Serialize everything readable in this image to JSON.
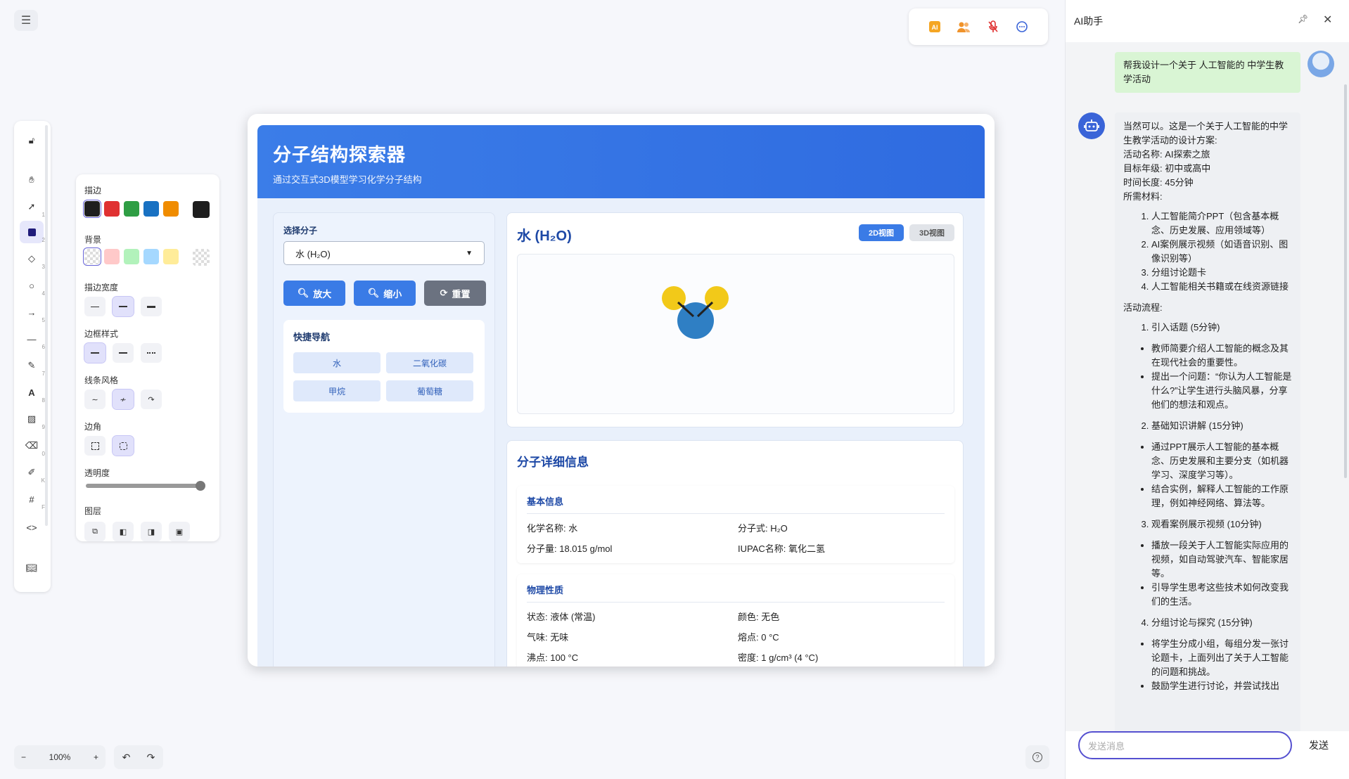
{
  "canvas": {
    "zoom": "100%",
    "zoom_out": "−",
    "zoom_in": "+",
    "undo": "↶",
    "redo": "↷",
    "help": "?"
  },
  "top_toolbar": {
    "icons": [
      "ai-badge-icon",
      "collaborators-icon",
      "mic-off-icon",
      "chat-icon"
    ]
  },
  "left_tools": {
    "keys": [
      "",
      "",
      "1",
      "2",
      "3",
      "4",
      "5",
      "6",
      "7",
      "8",
      "9",
      "0",
      "K",
      "F",
      ""
    ]
  },
  "props": {
    "stroke_label": "描边",
    "bg_label": "背景",
    "stroke_width_label": "描边宽度",
    "border_style_label": "边框样式",
    "line_style_label": "线条风格",
    "corner_label": "边角",
    "opacity_label": "透明度",
    "layer_label": "图层",
    "stroke_colors": [
      "#1e1e1e",
      "#e03131",
      "#2f9e44",
      "#1971c2",
      "#f08c00"
    ],
    "stroke_selected": "#1e1e1e",
    "bg_colors": [
      "transparent",
      "#ffc9c9",
      "#b2f2bb",
      "#a5d8ff",
      "#ffec99"
    ],
    "opacity": 100
  },
  "app": {
    "title": "分子结构探索器",
    "subtitle": "通过交互式3D模型学习化学分子结构",
    "select_label": "选择分子",
    "select_value": "水 (H₂O)",
    "zoom_in": "放大",
    "zoom_out": "缩小",
    "reset": "重置",
    "quick_nav_title": "快捷导航",
    "quick_nav": [
      "水",
      "二氧化碳",
      "甲烷",
      "葡萄糖"
    ],
    "view_title": "水 (H₂O)",
    "view_2d": "2D视图",
    "view_3d": "3D视图",
    "info_title": "分子详细信息",
    "basic_title": "基本信息",
    "basic": [
      {
        "k": "化学名称:",
        "v": "水"
      },
      {
        "k": "分子式:",
        "v": "H₂O"
      },
      {
        "k": "分子量:",
        "v": "18.015 g/mol"
      },
      {
        "k": "IUPAC名称:",
        "v": "氧化二氢"
      }
    ],
    "physical_title": "物理性质",
    "physical": [
      {
        "k": "状态:",
        "v": "液体 (常温)"
      },
      {
        "k": "颜色:",
        "v": "无色"
      },
      {
        "k": "气味:",
        "v": "无味"
      },
      {
        "k": "熔点:",
        "v": "0 °C"
      },
      {
        "k": "沸点:",
        "v": "100 °C"
      },
      {
        "k": "密度:",
        "v": "1 g/cm³ (4 °C)"
      }
    ],
    "colors": {
      "oxygen": "#2f7fc4",
      "hydrogen": "#f2c919",
      "header": "#3178e6"
    }
  },
  "ai": {
    "title": "AI助手",
    "user_message": "帮我设计一个关于 人工智能的 中学生教学活动",
    "bot_intro": [
      "当然可以。这是一个关于人工智能的中学生教学活动的设计方案:",
      "活动名称:  AI探索之旅",
      "目标年级:  初中或高中",
      "时间长度:  45分钟",
      "所需材料:"
    ],
    "materials": [
      "人工智能简介PPT（包含基本概念、历史发展、应用领域等）",
      "AI案例展示视频（如语音识别、图像识别等）",
      "分组讨论题卡",
      "人工智能相关书籍或在线资源链接"
    ],
    "flow_title": "活动流程:",
    "step1": "引入话题 (5分钟)",
    "step1_items": [
      "教师简要介绍人工智能的概念及其在现代社会的重要性。",
      "提出一个问题：“你认为人工智能是什么?”让学生进行头脑风暴，分享他们的想法和观点。"
    ],
    "step2": "基础知识讲解 (15分钟)",
    "step2_items": [
      "通过PPT展示人工智能的基本概念、历史发展和主要分支（如机器学习、深度学习等）。",
      "结合实例，解释人工智能的工作原理，例如神经网络、算法等。"
    ],
    "step3": "观看案例展示视频 (10分钟)",
    "step3_items": [
      "播放一段关于人工智能实际应用的视频，如自动驾驶汽车、智能家居等。",
      "引导学生思考这些技术如何改变我们的生活。"
    ],
    "step4": "分组讨论与探究 (15分钟)",
    "step4_items": [
      "将学生分成小组，每组分发一张讨论题卡，上面列出了关于人工智能的问题和挑战。",
      "鼓励学生进行讨论，并尝试找出"
    ],
    "input_placeholder": "发送消息",
    "send": "发送"
  }
}
